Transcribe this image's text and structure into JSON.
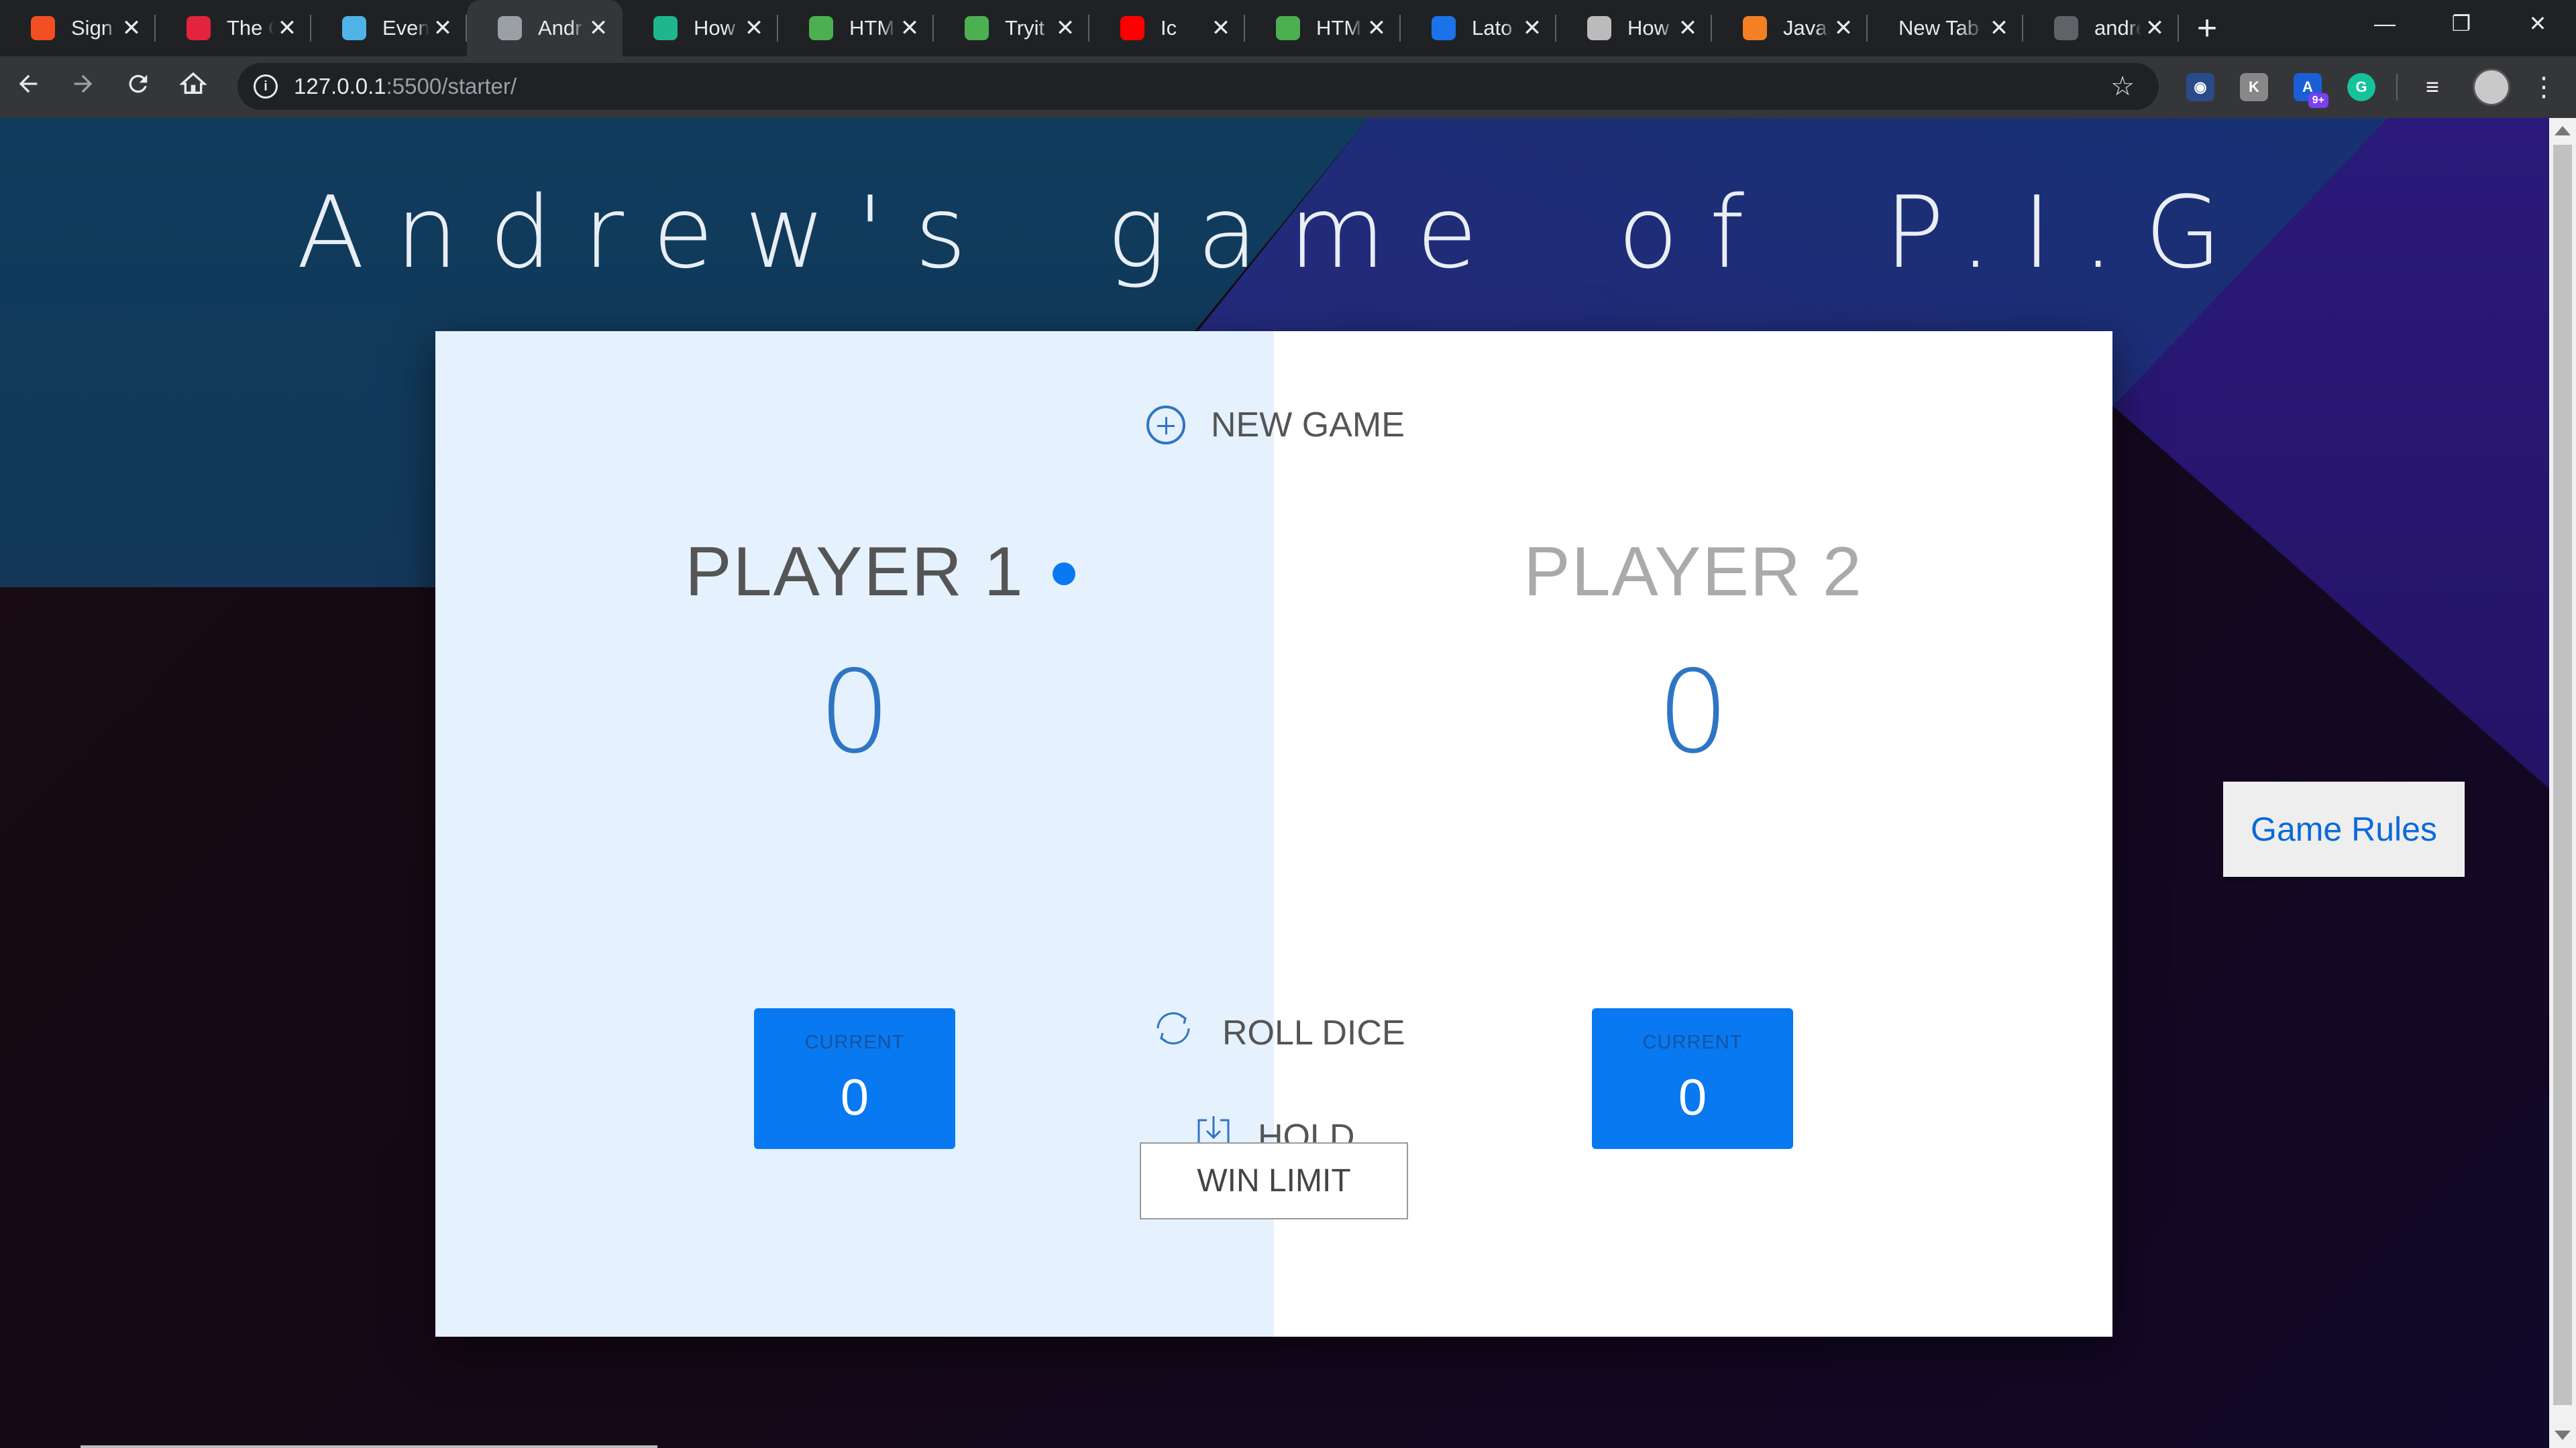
{
  "browser": {
    "tabs": [
      {
        "label": "Sign",
        "icon": "microsoft-icon",
        "color": "#f25022"
      },
      {
        "label": "The C",
        "icon": "u-logo-icon",
        "color": "#e2243d"
      },
      {
        "label": "Event",
        "icon": "event-icon",
        "color": "#4fb3e8"
      },
      {
        "label": "Andr",
        "icon": "globe-icon",
        "color": "#9aa0a6",
        "active": true
      },
      {
        "label": "How",
        "icon": "hex-icon",
        "color": "#1fb58f"
      },
      {
        "label": "HTMI",
        "icon": "w3-icon",
        "color": "#4caf50"
      },
      {
        "label": "Tryit I",
        "icon": "w3-icon",
        "color": "#4caf50"
      },
      {
        "label": "Ic",
        "icon": "youtube-icon",
        "color": "#ff0000"
      },
      {
        "label": "HTMI",
        "icon": "w3-icon",
        "color": "#4caf50"
      },
      {
        "label": "Lato",
        "icon": "f-icon",
        "color": "#1a73e8"
      },
      {
        "label": "How",
        "icon": "hex-icon",
        "color": "#bbbbbb"
      },
      {
        "label": "JavaS",
        "icon": "stack-icon",
        "color": "#f48024"
      },
      {
        "label": "New Tab",
        "icon": "",
        "color": ""
      },
      {
        "label": "andre",
        "icon": "github-icon",
        "color": "#5f6368"
      }
    ],
    "close_glyph": "✕",
    "new_tab_glyph": "+",
    "window_controls": [
      "—",
      "❐",
      "✕"
    ],
    "url_host": "127.0.0.1",
    "url_path": ":5500/starter/",
    "extension_badge": "9+"
  },
  "page": {
    "title": "Andrew's game of P.I.G",
    "new_game": "NEW GAME",
    "player1": {
      "name": "PLAYER 1",
      "score": "0",
      "current_label": "CURRENT",
      "current": "0"
    },
    "player2": {
      "name": "PLAYER 2",
      "score": "0",
      "current_label": "CURRENT",
      "current": "0"
    },
    "roll_dice": "ROLL DICE",
    "hold": "HOLD",
    "win_limit": "WIN LIMIT",
    "game_rules": "Game Rules"
  },
  "colors": {
    "accent": "#0879f0",
    "score": "#2f75c4",
    "panel_active": "#e6f1fe"
  }
}
